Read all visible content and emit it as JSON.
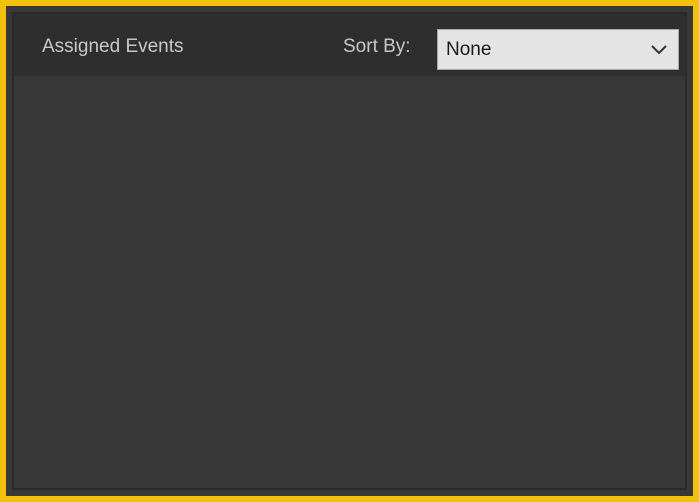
{
  "panel": {
    "title": "Assigned Events",
    "sort_label": "Sort By:",
    "sort_value": "None",
    "sort_icon": "chevron-down-icon",
    "events": []
  },
  "colors": {
    "highlight_border": "#f2c10c",
    "panel_bg": "#383838",
    "header_bg": "#2e2e2e",
    "dropdown_bg": "#e4e4e4",
    "label_text": "#c8c8c8"
  }
}
